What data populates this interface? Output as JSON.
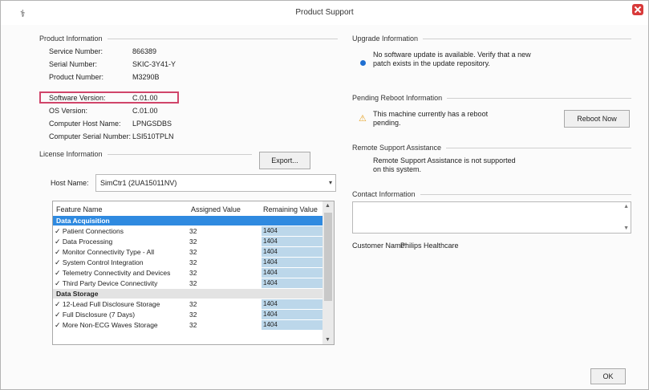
{
  "window": {
    "title": "Product Support",
    "close_label": "×"
  },
  "product_info": {
    "heading": "Product Information",
    "rows": [
      {
        "label": "Service Number:",
        "value": "866389"
      },
      {
        "label": "Serial Number:",
        "value": "SKIC-3Y41-Y"
      },
      {
        "label": "Product Number:",
        "value": "M3290B"
      },
      {
        "label": "Software Version:",
        "value": "C.01.00"
      },
      {
        "label": "OS Version:",
        "value": "C.01.00"
      },
      {
        "label": "Computer Host Name:",
        "value": "LPNGSDBS"
      },
      {
        "label": "Computer Serial Number:",
        "value": "LSI510TPLN"
      }
    ]
  },
  "license": {
    "heading": "License Information",
    "export_label": "Export...",
    "host_label": "Host Name:",
    "host_value": "SimCtr1 (2UA15011NV)",
    "columns": [
      "Feature Name",
      "Assigned Value",
      "Remaining Value"
    ],
    "rows": [
      {
        "type": "category",
        "name": "Data Acquisition",
        "selected": true
      },
      {
        "type": "item",
        "name": "Patient Connections",
        "assigned": "32",
        "remaining": "1404"
      },
      {
        "type": "item",
        "name": "Data Processing",
        "assigned": "32",
        "remaining": "1404"
      },
      {
        "type": "item",
        "name": "Monitor Connectivity Type - All",
        "assigned": "32",
        "remaining": "1404"
      },
      {
        "type": "item",
        "name": "System Control Integration",
        "assigned": "32",
        "remaining": "1404"
      },
      {
        "type": "item",
        "name": "Telemetry Connectivity and Devices",
        "assigned": "32",
        "remaining": "1404"
      },
      {
        "type": "item",
        "name": "Third Party Device Connectivity",
        "assigned": "32",
        "remaining": "1404"
      },
      {
        "type": "category",
        "name": "Data Storage",
        "selected": false
      },
      {
        "type": "item",
        "name": "12-Lead Full Disclosure Storage",
        "assigned": "32",
        "remaining": "1404"
      },
      {
        "type": "item",
        "name": "Full Disclosure (7 Days)",
        "assigned": "32",
        "remaining": "1404"
      },
      {
        "type": "item",
        "name": "More Non-ECG Waves Storage",
        "assigned": "32",
        "remaining": "1404"
      }
    ]
  },
  "upgrade": {
    "heading": "Upgrade Information",
    "message": "No software update is available. Verify that a new patch exists in the update repository."
  },
  "reboot": {
    "heading": "Pending Reboot Information",
    "message": "This machine currently has a reboot pending.",
    "button_label": "Reboot Now"
  },
  "remote": {
    "heading": "Remote Support Assistance",
    "message": "Remote Support Assistance is not supported on this system."
  },
  "contact": {
    "heading": "Contact Information",
    "customer_label": "Customer Name:",
    "customer_value": "Philips Healthcare"
  },
  "ok_label": "OK",
  "icons": {
    "app": "app-logo-icon",
    "info": "info-dot-icon",
    "warning": "warning-icon"
  },
  "colors": {
    "selection": "#2f8ae0",
    "highlight": "#d0456a",
    "remaining_cell": "#bcd7ea",
    "close": "#d83a3a"
  }
}
